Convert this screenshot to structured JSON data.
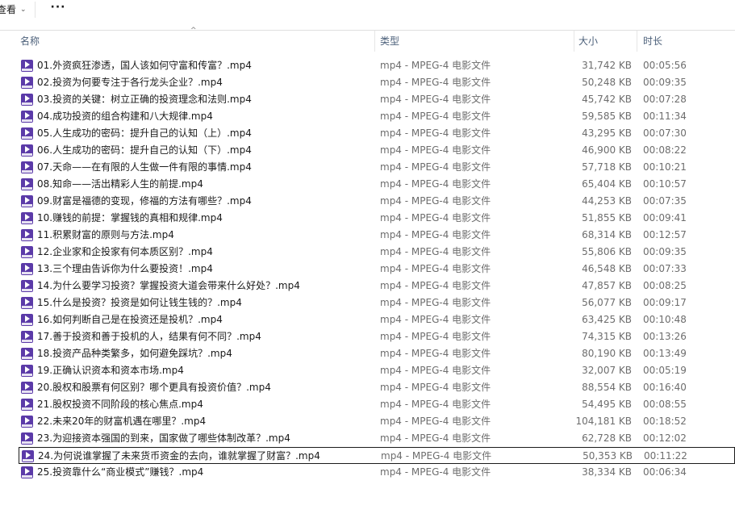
{
  "toolbar": {
    "view_label": "查看",
    "view_chevron": "⌄",
    "more_label": "···"
  },
  "header": {
    "name": "名称",
    "type": "类型",
    "size": "大小",
    "duration": "时长",
    "sort_indicator": "^"
  },
  "files": [
    {
      "name": "01.外资疯狂渗透，国人该如何守富和传富？.mp4",
      "type": "mp4 - MPEG-4 电影文件",
      "size": "31,742 KB",
      "duration": "00:05:56"
    },
    {
      "name": "02.投资为何要专注于各行龙头企业？.mp4",
      "type": "mp4 - MPEG-4 电影文件",
      "size": "50,248 KB",
      "duration": "00:09:35"
    },
    {
      "name": "03.投资的关键：树立正确的投资理念和法则.mp4",
      "type": "mp4 - MPEG-4 电影文件",
      "size": "45,742 KB",
      "duration": "00:07:28"
    },
    {
      "name": "04.成功投资的组合构建和八大规律.mp4",
      "type": "mp4 - MPEG-4 电影文件",
      "size": "59,585 KB",
      "duration": "00:11:34"
    },
    {
      "name": "05.人生成功的密码：提升自己的认知（上）.mp4",
      "type": "mp4 - MPEG-4 电影文件",
      "size": "43,295 KB",
      "duration": "00:07:30"
    },
    {
      "name": "06.人生成功的密码：提升自己的认知（下）.mp4",
      "type": "mp4 - MPEG-4 电影文件",
      "size": "46,900 KB",
      "duration": "00:08:22"
    },
    {
      "name": "07.天命——在有限的人生做一件有限的事情.mp4",
      "type": "mp4 - MPEG-4 电影文件",
      "size": "57,718 KB",
      "duration": "00:10:21"
    },
    {
      "name": "08.知命——活出精彩人生的前提.mp4",
      "type": "mp4 - MPEG-4 电影文件",
      "size": "65,404 KB",
      "duration": "00:10:57"
    },
    {
      "name": "09.财富是福德的变现，修福的方法有哪些？.mp4",
      "type": "mp4 - MPEG-4 电影文件",
      "size": "44,253 KB",
      "duration": "00:07:35"
    },
    {
      "name": "10.赚钱的前提：掌握钱的真相和规律.mp4",
      "type": "mp4 - MPEG-4 电影文件",
      "size": "51,855 KB",
      "duration": "00:09:41"
    },
    {
      "name": "11.积累财富的原则与方法.mp4",
      "type": "mp4 - MPEG-4 电影文件",
      "size": "68,314 KB",
      "duration": "00:12:57"
    },
    {
      "name": "12.企业家和企投家有何本质区别？.mp4",
      "type": "mp4 - MPEG-4 电影文件",
      "size": "55,806 KB",
      "duration": "00:09:35"
    },
    {
      "name": "13.三个理由告诉你为什么要投资！.mp4",
      "type": "mp4 - MPEG-4 电影文件",
      "size": "46,548 KB",
      "duration": "00:07:33"
    },
    {
      "name": "14.为什么要学习投资？掌握投资大道会带来什么好处？.mp4",
      "type": "mp4 - MPEG-4 电影文件",
      "size": "47,857 KB",
      "duration": "00:08:25"
    },
    {
      "name": "15.什么是投资？投资是如何让钱生钱的？.mp4",
      "type": "mp4 - MPEG-4 电影文件",
      "size": "56,077 KB",
      "duration": "00:09:17"
    },
    {
      "name": "16.如何判断自己是在投资还是投机？.mp4",
      "type": "mp4 - MPEG-4 电影文件",
      "size": "63,425 KB",
      "duration": "00:10:48"
    },
    {
      "name": "17.善于投资和善于投机的人，结果有何不同？.mp4",
      "type": "mp4 - MPEG-4 电影文件",
      "size": "74,315 KB",
      "duration": "00:13:26"
    },
    {
      "name": "18.投资产品种类繁多，如何避免踩坑？.mp4",
      "type": "mp4 - MPEG-4 电影文件",
      "size": "80,190 KB",
      "duration": "00:13:49"
    },
    {
      "name": "19.正确认识资本和资本市场.mp4",
      "type": "mp4 - MPEG-4 电影文件",
      "size": "32,007 KB",
      "duration": "00:05:19"
    },
    {
      "name": "20.股权和股票有何区别？哪个更具有投资价值？.mp4",
      "type": "mp4 - MPEG-4 电影文件",
      "size": "88,554 KB",
      "duration": "00:16:40"
    },
    {
      "name": "21.股权投资不同阶段的核心焦点.mp4",
      "type": "mp4 - MPEG-4 电影文件",
      "size": "54,495 KB",
      "duration": "00:08:55"
    },
    {
      "name": "22.未来20年的财富机遇在哪里？.mp4",
      "type": "mp4 - MPEG-4 电影文件",
      "size": "104,181 KB",
      "duration": "00:18:52"
    },
    {
      "name": "23.为迎接资本强国的到来，国家做了哪些体制改革？.mp4",
      "type": "mp4 - MPEG-4 电影文件",
      "size": "62,728 KB",
      "duration": "00:12:02"
    },
    {
      "name": "24.为何说谁掌握了未来货币资金的去向，谁就掌握了财富？.mp4",
      "type": "mp4 - MPEG-4 电影文件",
      "size": "50,353 KB",
      "duration": "00:11:22",
      "focused": true
    },
    {
      "name": "25.投资靠什么“商业模式”赚钱？.mp4",
      "type": "mp4 - MPEG-4 电影文件",
      "size": "38,334 KB",
      "duration": "00:06:34"
    }
  ],
  "colors": {
    "header_text": "#4c607a",
    "icon_fill": "#5b3aa8",
    "secondary_text": "#6d6d6d"
  },
  "icons": {
    "file_icon": "mp4-video-file-icon"
  }
}
